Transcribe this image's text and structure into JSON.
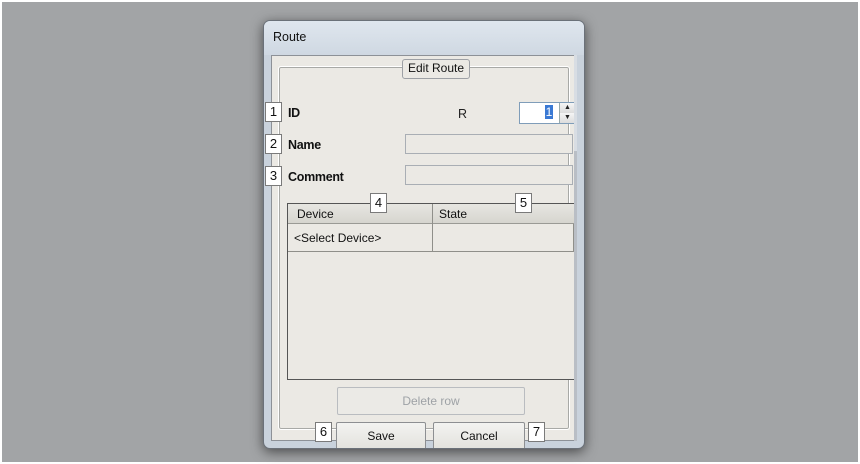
{
  "window": {
    "title": "Route"
  },
  "group": {
    "title": "Edit Route"
  },
  "fields": {
    "id": {
      "badge": "1",
      "label": "ID",
      "route_prefix": "R",
      "value": "1"
    },
    "name": {
      "badge": "2",
      "label": "Name",
      "value": ""
    },
    "comment": {
      "badge": "3",
      "label": "Comment",
      "value": ""
    }
  },
  "table": {
    "columns": [
      {
        "badge": "4",
        "label": "Device"
      },
      {
        "badge": "5",
        "label": "State"
      }
    ],
    "rows": [
      {
        "device": "<Select Device>",
        "state": ""
      }
    ]
  },
  "buttons": {
    "delete_row": "Delete row",
    "save": {
      "badge": "6",
      "label": "Save"
    },
    "cancel": {
      "badge": "7",
      "label": "Cancel"
    }
  },
  "icons": [
    "spin-up-icon",
    "spin-down-icon"
  ]
}
